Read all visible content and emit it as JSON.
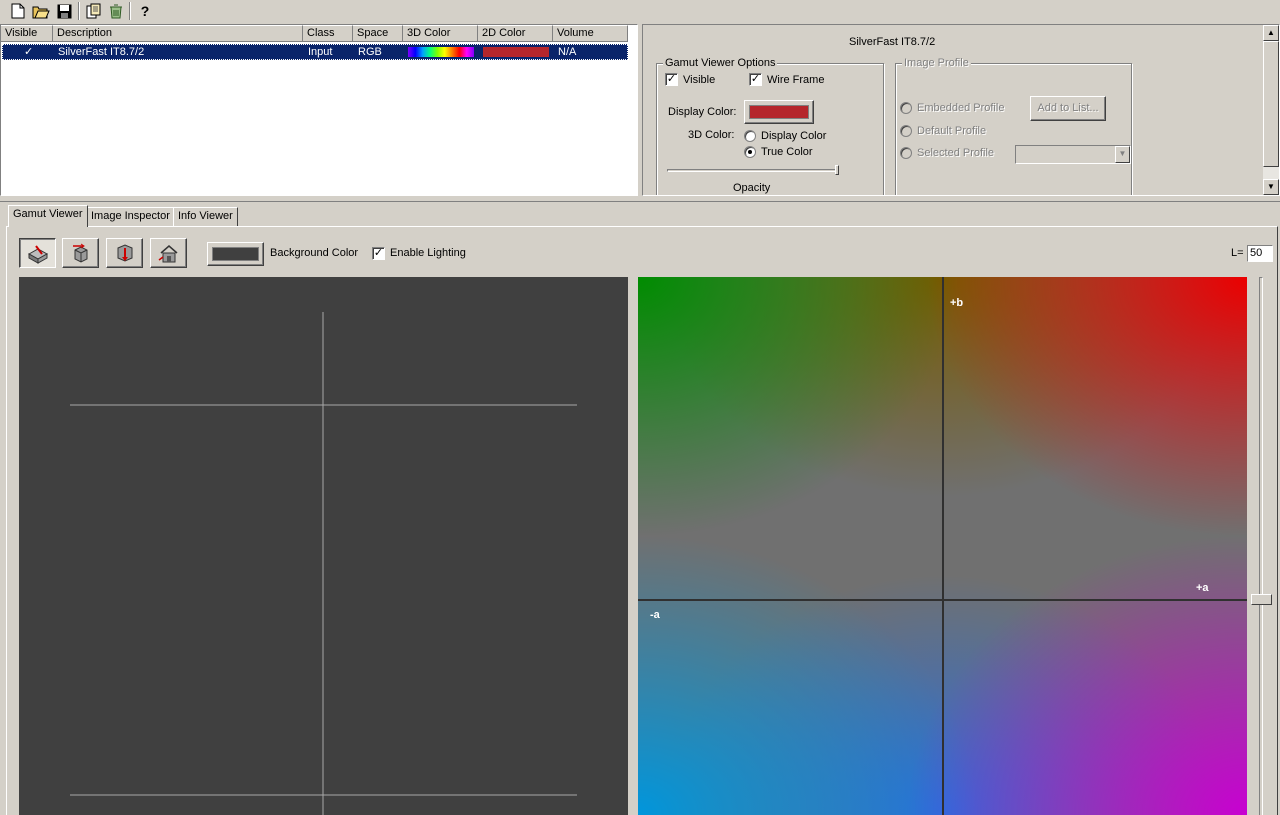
{
  "toolbar": {
    "icons": [
      "new-file-icon",
      "open-folder-icon",
      "save-icon",
      "copy-icon",
      "recycle-icon",
      "help-icon"
    ],
    "help_label": "?"
  },
  "profile_list": {
    "columns": [
      "Visible",
      "Description",
      "Class",
      "Space",
      "3D Color",
      "2D Color",
      "Volume"
    ],
    "rows": [
      {
        "visible": "✓",
        "description": "SilverFast IT8.7/2",
        "class": "Input",
        "space": "RGB",
        "color_2d": "#b5262c",
        "volume": "N/A"
      }
    ]
  },
  "options_panel": {
    "title": "SilverFast IT8.7/2",
    "gamut_group": {
      "title": "Gamut Viewer Options",
      "visible_label": "Visible",
      "visible_checked": "✓",
      "wire_frame_label": "Wire Frame",
      "wire_frame_checked": "✓",
      "display_color_label": "Display Color:",
      "display_color": "#b5262c",
      "color3d_label": "3D Color:",
      "radio_display_color": "Display Color",
      "radio_true_color": "True Color",
      "selected_3d_color": "True Color",
      "opacity_label": "Opacity",
      "opacity": 1.0
    },
    "image_profile_group": {
      "title": "Image Profile",
      "embedded_label": "Embedded Profile",
      "add_to_list_label": "Add to List...",
      "default_label": "Default Profile",
      "selected_label": "Selected Profile",
      "selected_value": ""
    }
  },
  "tabs": [
    "Gamut Viewer",
    "Image Inspector",
    "Info Viewer"
  ],
  "active_tab": "Gamut Viewer",
  "viewer_toolbar": {
    "tools": [
      "view-3d-icon",
      "rotate-icon",
      "move-down-icon",
      "home-view-icon"
    ],
    "background_color_label": "Background Color",
    "background_color": "#404040",
    "enable_lighting_label": "Enable Lighting",
    "enable_lighting_checked": "✓",
    "l_label": "L=",
    "l_value": "50"
  },
  "ab_plot": {
    "plus_b": "+b",
    "plus_a": "+a",
    "minus_a": "-a",
    "l_slider_value": 50
  },
  "colors": {
    "window_bg": "#d4d0c8",
    "selection_bg": "#0a246a",
    "viewer_bg": "#404040"
  }
}
